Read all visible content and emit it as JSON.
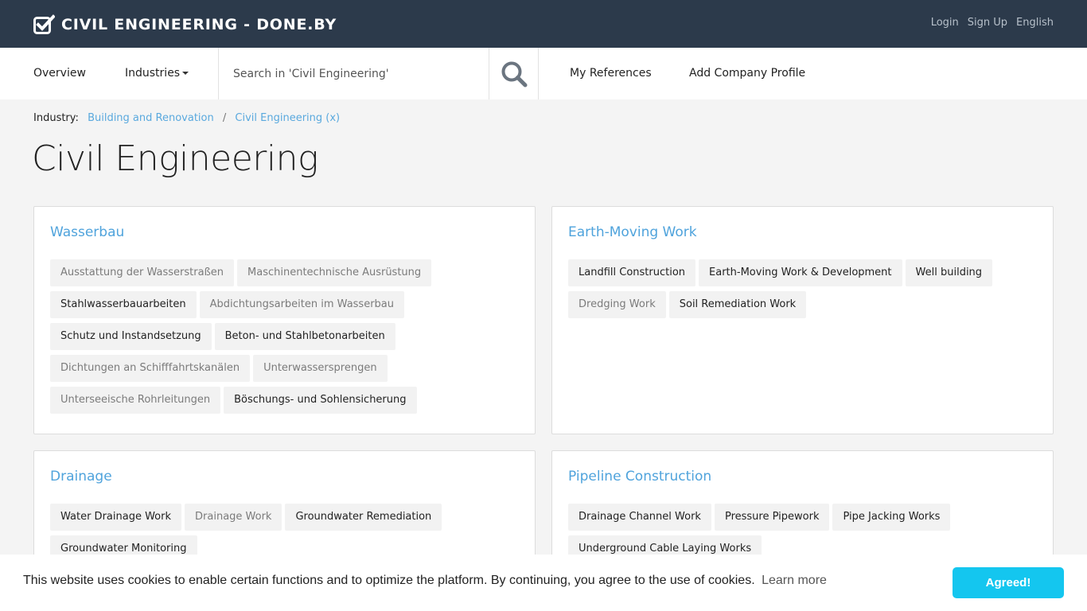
{
  "header": {
    "brand": "CIVIL ENGINEERING - DONE.BY",
    "links": [
      {
        "label": "Login"
      },
      {
        "label": "Sign Up"
      },
      {
        "label": "English"
      }
    ]
  },
  "nav": {
    "overview": "Overview",
    "industries": "Industries",
    "search_placeholder": "Search in 'Civil Engineering'",
    "my_references": "My References",
    "add_company": "Add Company Profile"
  },
  "breadcrumb": {
    "label": "Industry:",
    "items": [
      "Building and Renovation",
      "Civil Engineering (x)"
    ]
  },
  "page": {
    "title": "Civil Engineering"
  },
  "cards": [
    {
      "title": "Wasserbau",
      "tags": [
        {
          "label": "Ausstattung der Wasserstraßen",
          "style": "dim"
        },
        {
          "label": "Maschinentechnische Ausrüstung",
          "style": "dim"
        },
        {
          "label": "Stahlwasserbauarbeiten",
          "style": "dark"
        },
        {
          "label": "Abdichtungsarbeiten im Wasserbau",
          "style": "dim"
        },
        {
          "label": "Schutz und Instandsetzung",
          "style": "dark"
        },
        {
          "label": "Beton- und Stahlbetonarbeiten",
          "style": "dark"
        },
        {
          "label": "Dichtungen an Schifffahrtskanälen",
          "style": "dim"
        },
        {
          "label": "Unterwassersprengen",
          "style": "dim"
        },
        {
          "label": "Unterseeische Rohrleitungen",
          "style": "dim"
        },
        {
          "label": "Böschungs- und Sohlensicherung",
          "style": "dark"
        }
      ]
    },
    {
      "title": "Earth-Moving Work",
      "tags": [
        {
          "label": "Landfill Construction",
          "style": "dark"
        },
        {
          "label": "Earth-Moving Work & Development",
          "style": "dark"
        },
        {
          "label": "Well building",
          "style": "dark"
        },
        {
          "label": "Dredging Work",
          "style": "dim"
        },
        {
          "label": "Soil Remediation Work",
          "style": "dark"
        }
      ]
    },
    {
      "title": "Drainage",
      "tags": [
        {
          "label": "Water Drainage Work",
          "style": "dark"
        },
        {
          "label": "Drainage Work",
          "style": "dim"
        },
        {
          "label": "Groundwater Remediation",
          "style": "dark"
        },
        {
          "label": "Groundwater Monitoring",
          "style": "dark"
        }
      ]
    },
    {
      "title": "Pipeline Construction",
      "tags": [
        {
          "label": "Drainage Channel Work",
          "style": "dark"
        },
        {
          "label": "Pressure Pipework",
          "style": "dark"
        },
        {
          "label": "Pipe Jacking Works",
          "style": "dark"
        },
        {
          "label": "Underground Cable Laying Works",
          "style": "dark"
        }
      ]
    }
  ],
  "cookie": {
    "text": "This website uses cookies to enable certain functions and to optimize the platform. By continuing, you agree to the use of cookies.",
    "link": "Learn more",
    "button": "Agreed!"
  },
  "colors": {
    "header_bg": "#2c3a4b",
    "accent": "#4fa3dc",
    "cookie_button": "#14c6ef"
  },
  "icons": {
    "brand": "checkbox-check-icon",
    "search": "magnifier-icon",
    "industries": "caret-down-icon"
  }
}
